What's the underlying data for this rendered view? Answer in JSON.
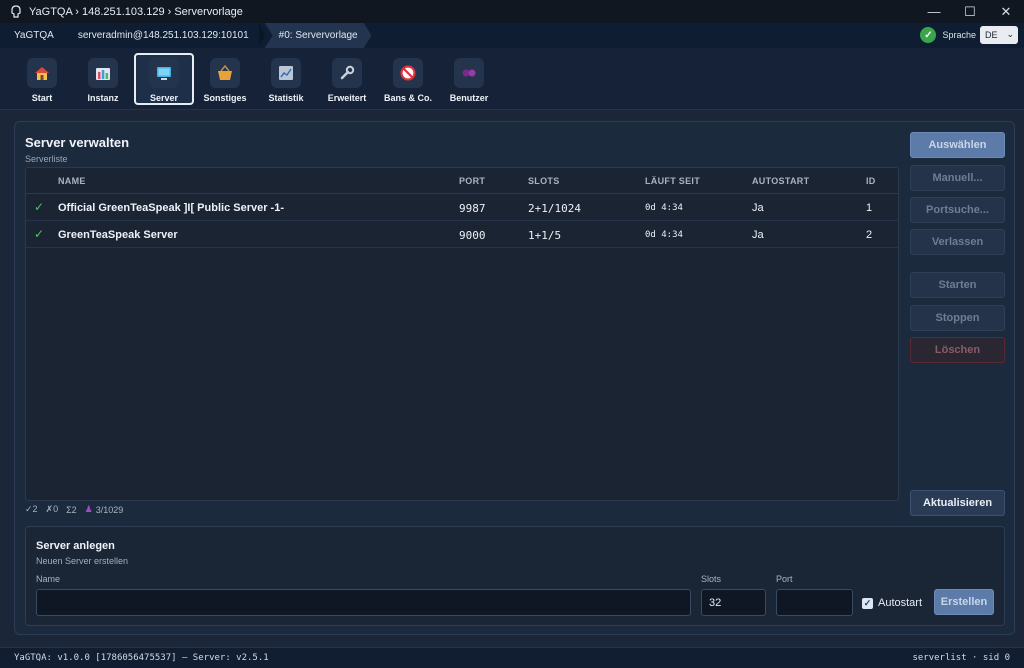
{
  "window": {
    "title": "YaGTQA › 148.251.103.129 › Servervorlage",
    "controls": {
      "minimize": "—",
      "maximize": "☐",
      "close": "✕"
    }
  },
  "breadcrumb": {
    "items": [
      "YaGTQA",
      "serveradmin@148.251.103.129:10101",
      "#0: Servervorlage"
    ],
    "status_icon": "check-circle-icon",
    "language_label": "Sprache",
    "language_value": "DE"
  },
  "toolbar": {
    "items": [
      {
        "label": "Start",
        "icon": "home-icon"
      },
      {
        "label": "Instanz",
        "icon": "instance-icon"
      },
      {
        "label": "Server",
        "icon": "server-monitor-icon",
        "active": true
      },
      {
        "label": "Sonstiges",
        "icon": "basket-icon"
      },
      {
        "label": "Statistik",
        "icon": "chart-icon"
      },
      {
        "label": "Erweitert",
        "icon": "wrench-icon"
      },
      {
        "label": "Bans & Co.",
        "icon": "ban-icon"
      },
      {
        "label": "Benutzer",
        "icon": "users-icon"
      }
    ]
  },
  "main": {
    "title": "Server verwalten",
    "subtitle": "Serverliste",
    "table": {
      "headers": [
        "NAME",
        "PORT",
        "SLOTS",
        "LÄUFT SEIT",
        "AUTOSTART",
        "ID"
      ],
      "rows": [
        {
          "status": "✓",
          "name": "Official GreenTeaSpeak ]I[ Public Server -1-",
          "port": "9987",
          "slots": "2+1/1024",
          "uptime": "0d 4:34",
          "autostart": "Ja",
          "id": "1"
        },
        {
          "status": "✓",
          "name": "GreenTeaSpeak Server",
          "port": "9000",
          "slots": "1+1/5",
          "uptime": "0d 4:34",
          "autostart": "Ja",
          "id": "2"
        }
      ]
    },
    "stats": {
      "ok": "✓2",
      "err": "✗0",
      "sum": "Σ2",
      "clients": "3/1029"
    },
    "actions": {
      "select": "Auswählen",
      "manual": "Manuell...",
      "portsearch": "Portsuche...",
      "leave": "Verlassen",
      "start": "Starten",
      "stop": "Stoppen",
      "delete": "Löschen",
      "refresh": "Aktualisieren"
    }
  },
  "create": {
    "title": "Server anlegen",
    "subtitle": "Neuen Server erstellen",
    "name_label": "Name",
    "name_value": "",
    "slots_label": "Slots",
    "slots_value": "32",
    "port_label": "Port",
    "port_value": "",
    "autostart_label": "Autostart",
    "autostart_checked": true,
    "submit": "Erstellen"
  },
  "statusbar": {
    "left": "YaGTQA: v1.0.0 [1786056475537] — Server: v2.5.1",
    "right": "serverlist · sid 0"
  },
  "colors": {
    "accent": "#5c7ba8",
    "ok": "#4cc76a",
    "danger": "#5a2a34"
  }
}
